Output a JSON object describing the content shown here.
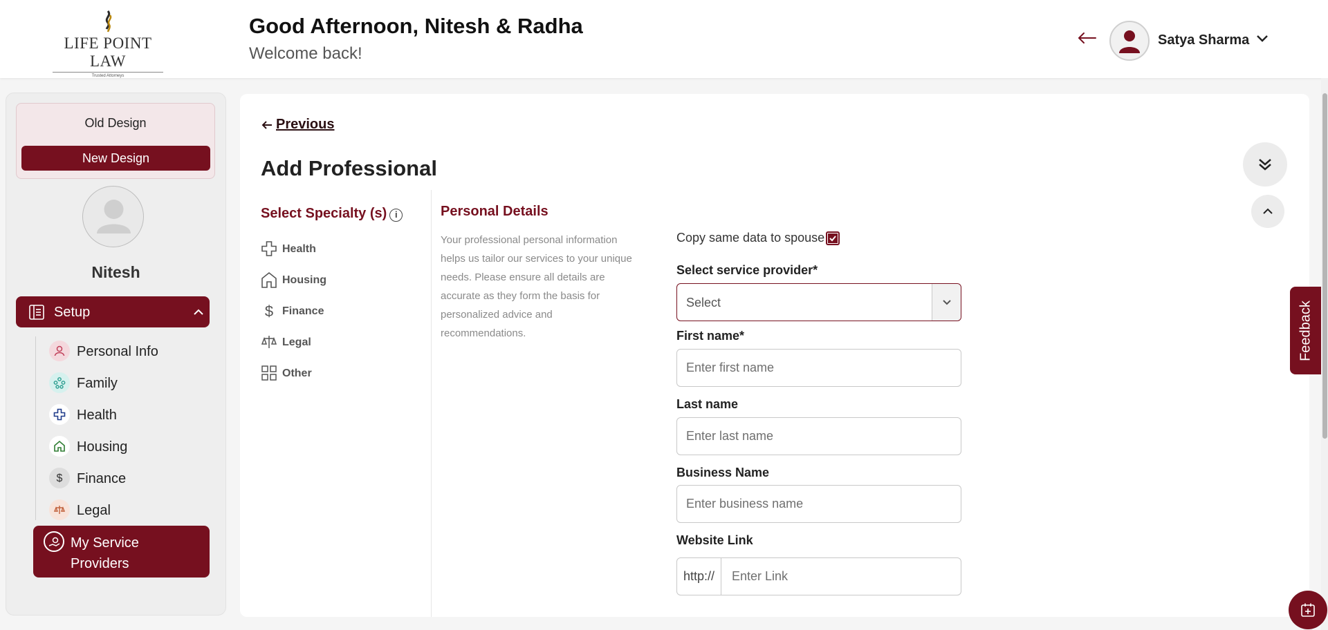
{
  "header": {
    "logo_text": "LIFE POINT LAW",
    "logo_tagline": "Trusted Attorneys",
    "greeting": "Good Afternoon, Nitesh & Radha",
    "subtitle": "Welcome back!",
    "user_name": "Satya Sharma"
  },
  "sidebar": {
    "old_design": "Old Design",
    "new_design": "New Design",
    "profile_name": "Nitesh",
    "setup_label": "Setup",
    "items": [
      {
        "label": "Personal Info",
        "icon": "person-icon",
        "color": "#c0405a"
      },
      {
        "label": "Family",
        "icon": "family-icon",
        "color": "#2a9d8f"
      },
      {
        "label": "Health",
        "icon": "health-cross-icon",
        "color": "#1e3a8a"
      },
      {
        "label": "Housing",
        "icon": "house-icon",
        "color": "#2e7d32"
      },
      {
        "label": "Finance",
        "icon": "dollar-icon",
        "color": "#333333"
      },
      {
        "label": "Legal",
        "icon": "scale-icon",
        "color": "#c0603a"
      }
    ],
    "active_item": "My Service Providers"
  },
  "main": {
    "previous": "Previous",
    "title": "Add Professional",
    "specialty_title": "Select Specialty (s)",
    "specialties": [
      "Health",
      "Housing",
      "Finance",
      "Legal",
      "Other"
    ],
    "section_title": "Personal Details",
    "section_desc": "Your professional personal information helps us tailor our services to your unique needs. Please ensure all details are accurate as they form the basis for personalized advice and recommendations.",
    "copy_label": "Copy same data to spouse",
    "copy_checked": true,
    "provider_label": "Select service provider*",
    "provider_value": "Select",
    "first_name_label": "First name*",
    "first_name_placeholder": "Enter first name",
    "last_name_label": "Last name",
    "last_name_placeholder": "Enter last name",
    "business_label": "Business Name",
    "business_placeholder": "Enter business name",
    "website_label": "Website Link",
    "website_prefix": "http://",
    "website_placeholder": "Enter Link"
  },
  "feedback": "Feedback",
  "colors": {
    "brand": "#76101f",
    "brand_light": "#f3e7e9"
  }
}
